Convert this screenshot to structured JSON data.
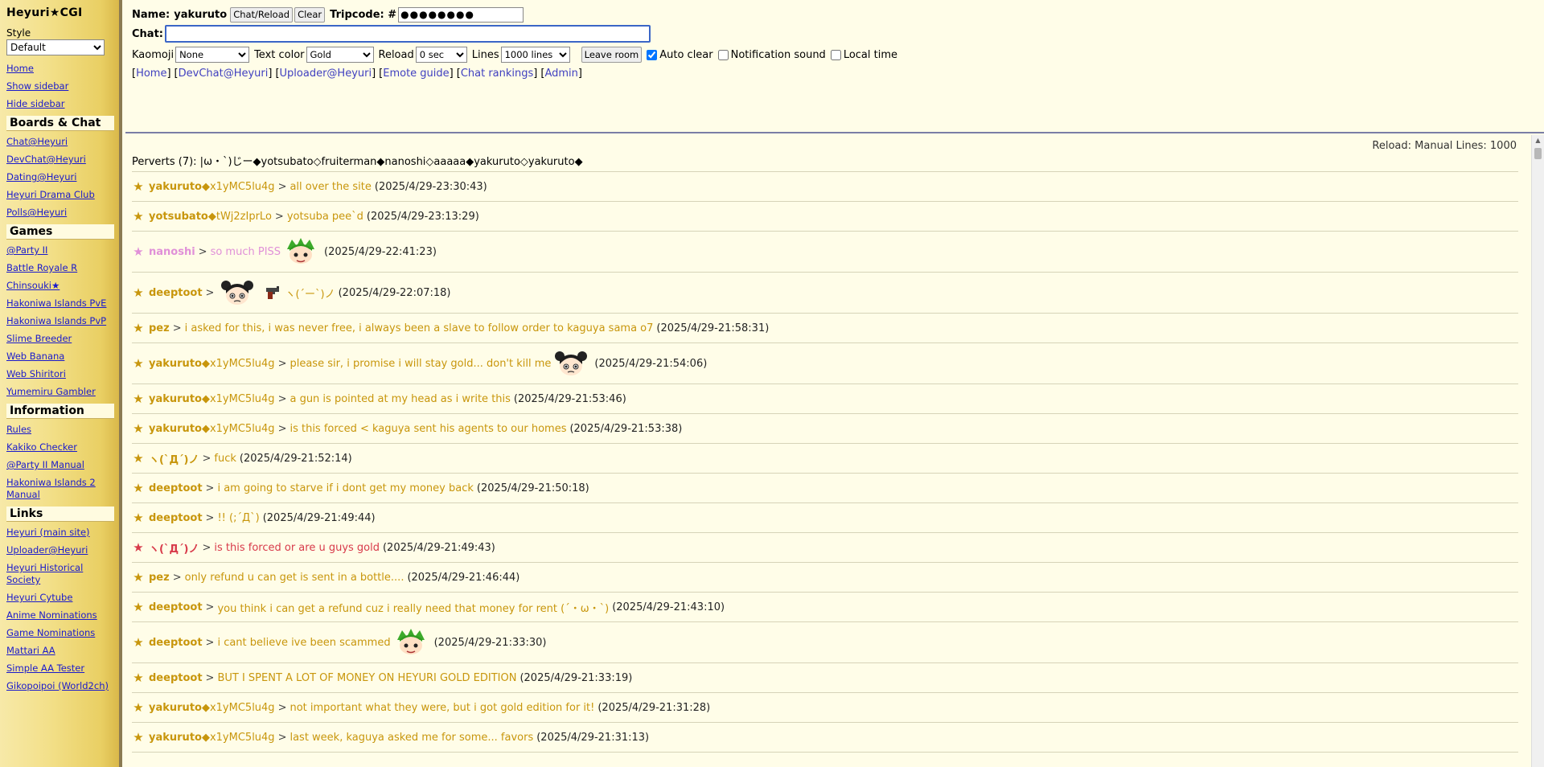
{
  "sidebar": {
    "title": "Heyuri★CGI",
    "style_label": "Style",
    "style_value": "Default",
    "top_links": [
      "Home",
      "Show sidebar",
      "Hide sidebar"
    ],
    "sections": [
      {
        "title": "Boards & Chat",
        "links": [
          "Chat@Heyuri",
          "DevChat@Heyuri",
          "Dating@Heyuri",
          "Heyuri Drama Club",
          "Polls@Heyuri"
        ]
      },
      {
        "title": "Games",
        "links": [
          "@Party II",
          "Battle Royale R",
          "Chinsouki★",
          "Hakoniwa Islands PvE",
          "Hakoniwa Islands PvP",
          "Slime Breeder",
          "Web Banana",
          "Web Shiritori",
          "Yumemiru Gambler"
        ]
      },
      {
        "title": "Information",
        "links": [
          "Rules",
          "Kakiko Checker",
          "@Party II Manual",
          "Hakoniwa Islands 2 Manual"
        ]
      },
      {
        "title": "Links",
        "links": [
          "Heyuri (main site)",
          "Uploader@Heyuri",
          "Heyuri Historical Society",
          "Heyuri Cytube",
          "Anime Nominations",
          "Game Nominations",
          "Mattari AA",
          "Simple AA Tester",
          "Gikopoipoi (World2ch)"
        ]
      }
    ]
  },
  "header": {
    "name_label": "Name:",
    "name_value": "yakuruto",
    "reload_button": "Chat/Reload",
    "clear_button": "Clear",
    "tripcode_label": "Tripcode: #",
    "tripcode_value": "●●●●●●●●",
    "chat_label": "Chat:",
    "chat_value": "",
    "kaomoji_label": "Kaomoji",
    "kaomoji_value": "None",
    "color_label": "Text color",
    "color_value": "Gold",
    "reload_label": "Reload",
    "reload_value": "0 sec",
    "lines_label": "Lines",
    "lines_value": "1000 lines",
    "leave_button": "Leave room",
    "auto_clear": "Auto clear",
    "notification": "Notification sound",
    "local_time": "Local time",
    "nav_links": [
      "Home",
      "DevChat@Heyuri",
      "Uploader@Heyuri",
      "Emote guide",
      "Chat rankings",
      "Admin"
    ]
  },
  "log": {
    "reload_info": "Reload: Manual Lines: 1000",
    "perverts": "Perverts (7): |ω・`)じー◆yotsubato◇fruiterman◆nanoshi◇aaaaa◆yakuruto◇yakuruto◆",
    "messages": [
      {
        "name": "yakuruto",
        "trip": "◆x1yMC5lu4g",
        "text": "all over the site",
        "time": "(2025/4/29-23:30:43)",
        "color": "#c8960c",
        "emote": ""
      },
      {
        "name": "yotsubato",
        "trip": "◆tWj2zIprLo",
        "text": "yotsuba pee`d",
        "time": "(2025/4/29-23:13:29)",
        "color": "#c8960c",
        "emote": ""
      },
      {
        "name": "nanoshi",
        "trip": "",
        "text": "so much PISS",
        "time": "(2025/4/29-22:41:23)",
        "color": "#e090d8",
        "emote": "green-hair-emote"
      },
      {
        "name": "deeptoot",
        "trip": "",
        "text": "ヽ(´ー`)ノ",
        "time": "(2025/4/29-22:07:18)",
        "color": "#c8960c",
        "emote": "gun-emote"
      },
      {
        "name": "pez",
        "trip": "",
        "text": "i asked for this, i was never free, i always been a slave to follow order to kaguya sama o7",
        "time": "(2025/4/29-21:58:31)",
        "color": "#c8960c",
        "emote": ""
      },
      {
        "name": "yakuruto",
        "trip": "◆x1yMC5lu4g",
        "text": "please sir, i promise i will stay gold... don't kill me",
        "time": "(2025/4/29-21:54:06)",
        "color": "#c8960c",
        "emote": "dark-hair-emote"
      },
      {
        "name": "yakuruto",
        "trip": "◆x1yMC5lu4g",
        "text": "a gun is pointed at my head as i write this",
        "time": "(2025/4/29-21:53:46)",
        "color": "#c8960c",
        "emote": ""
      },
      {
        "name": "yakuruto",
        "trip": "◆x1yMC5lu4g",
        "text": "is this forced < kaguya sent his agents to our homes",
        "time": "(2025/4/29-21:53:38)",
        "color": "#c8960c",
        "emote": ""
      },
      {
        "name": "ヽ(`Д´)ノ",
        "trip": "",
        "text": "fuck",
        "time": "(2025/4/29-21:52:14)",
        "color": "#c8960c",
        "emote": ""
      },
      {
        "name": "deeptoot",
        "trip": "",
        "text": "i am going to starve if i dont get my money back",
        "time": "(2025/4/29-21:50:18)",
        "color": "#c8960c",
        "emote": ""
      },
      {
        "name": "deeptoot",
        "trip": "",
        "text": "!! (;´Д`)",
        "time": "(2025/4/29-21:49:44)",
        "color": "#c8960c",
        "emote": ""
      },
      {
        "name": "ヽ(`Д´)ノ",
        "trip": "",
        "text": "is this forced or are u guys gold",
        "time": "(2025/4/29-21:49:43)",
        "color": "#d83a4a",
        "emote": ""
      },
      {
        "name": "pez",
        "trip": "",
        "text": "only refund u can get is sent in a bottle....",
        "time": "(2025/4/29-21:46:44)",
        "color": "#c8960c",
        "emote": ""
      },
      {
        "name": "deeptoot",
        "trip": "",
        "text": "you think i can get a refund cuz i really need that money for rent (´・ω・`)",
        "time": "(2025/4/29-21:43:10)",
        "color": "#c8960c",
        "emote": ""
      },
      {
        "name": "deeptoot",
        "trip": "",
        "text": "i cant believe ive been scammed",
        "time": "(2025/4/29-21:33:30)",
        "color": "#c8960c",
        "emote": "green-hair-emote"
      },
      {
        "name": "deeptoot",
        "trip": "",
        "text": "BUT I SPENT A LOT OF MONEY ON HEYURI GOLD EDITION",
        "time": "(2025/4/29-21:33:19)",
        "color": "#c8960c",
        "emote": ""
      },
      {
        "name": "yakuruto",
        "trip": "◆x1yMC5lu4g",
        "text": "not important what they were, but i got gold edition for it!",
        "time": "(2025/4/29-21:31:28)",
        "color": "#c8960c",
        "emote": ""
      },
      {
        "name": "yakuruto",
        "trip": "◆x1yMC5lu4g",
        "text": "last week, kaguya asked me for some... favors",
        "time": "(2025/4/29-21:31:13)",
        "color": "#c8960c",
        "emote": ""
      }
    ]
  }
}
